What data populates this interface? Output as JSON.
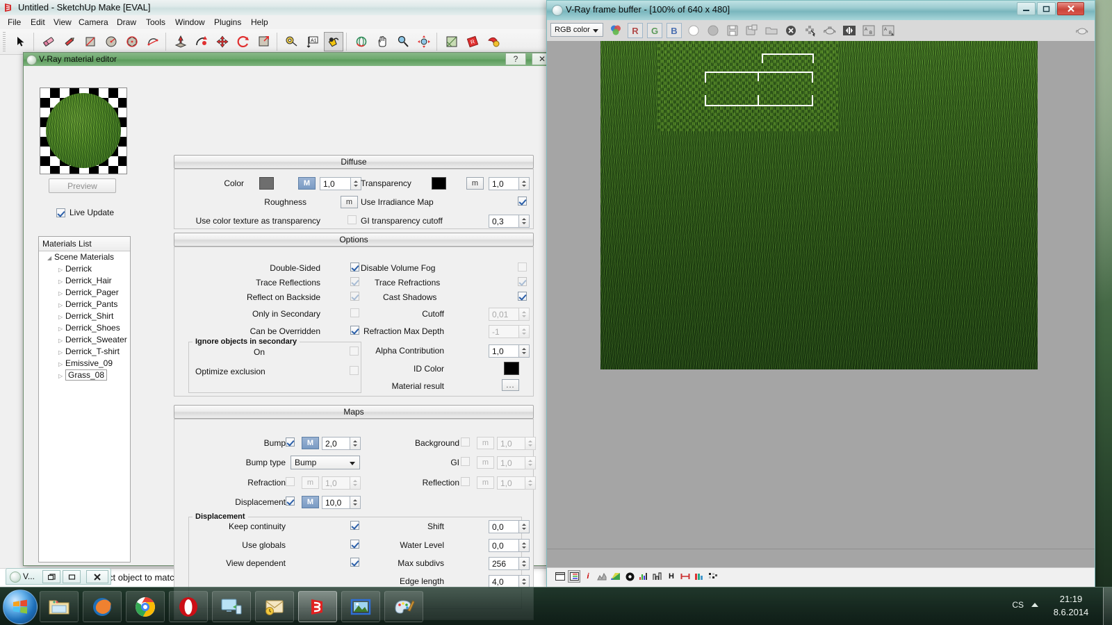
{
  "sketchup": {
    "title": "Untitled - SketchUp Make [EVAL]",
    "menu": [
      "File",
      "Edit",
      "View",
      "Camera",
      "Draw",
      "Tools",
      "Window",
      "Plugins",
      "Help"
    ],
    "toolbar_icons": [
      "select-arrow-icon",
      "eraser-icon",
      "pencil-icon",
      "rectangle-icon",
      "circle-icon",
      "polygon-icon",
      "arc-icon",
      "pushpull-icon",
      "follow-me-icon",
      "move-icon",
      "rotate-icon",
      "scale-icon",
      "tape-measure-icon",
      "text-icon",
      "paint-bucket-icon",
      "orbit-icon",
      "pan-icon",
      "zoom-icon",
      "zoom-extents-icon",
      "section-plane-icon",
      "vray-render-icon",
      "vray-materials-icon"
    ],
    "status_text": "ct object to match paint from"
  },
  "material_editor": {
    "title": "V-Ray material editor",
    "help_label": "?",
    "close_label": "✕",
    "preview_button": "Preview",
    "live_update_label": "Live Update",
    "live_update_checked": true,
    "materials_list": {
      "header": "Materials List",
      "root": "Scene Materials",
      "items": [
        "Derrick",
        "Derrick_Hair",
        "Derrick_Pager",
        "Derrick_Pants",
        "Derrick_Shirt",
        "Derrick_Shoes",
        "Derrick_Sweater",
        "Derrick_T-shirt",
        "Emissive_09",
        "Grass_08"
      ],
      "selected": "Grass_08"
    },
    "diffuse": {
      "header": "Diffuse",
      "color_label": "Color",
      "color_swatch": "#6e6e6e",
      "color_map_button": "M",
      "color_value": "1,0",
      "transparency_label": "Transparency",
      "transparency_swatch": "#000000",
      "transparency_map_button": "m",
      "transparency_value": "1,0",
      "roughness_label": "Roughness",
      "roughness_map_button": "m",
      "use_irradiance_map_label": "Use Irradiance Map",
      "use_irradiance_map_checked": true,
      "use_color_texture_label": "Use color texture as transparency",
      "use_color_texture_checked": false,
      "gi_transparency_cutoff_label": "GI transparency cutoff",
      "gi_transparency_cutoff_value": "0,3"
    },
    "options": {
      "header": "Options",
      "left": [
        {
          "label": "Double-Sided",
          "checked": true,
          "enabled": true
        },
        {
          "label": "Trace Reflections",
          "checked": true,
          "enabled": false
        },
        {
          "label": "Reflect on Backside",
          "checked": true,
          "enabled": false
        },
        {
          "label": "Only in Secondary",
          "checked": false,
          "enabled": true
        },
        {
          "label": "Can be Overridden",
          "checked": true,
          "enabled": true
        }
      ],
      "right": [
        {
          "label": "Disable Volume Fog",
          "checked": false,
          "enabled": true
        },
        {
          "label": "Trace Refractions",
          "checked": true,
          "enabled": false
        },
        {
          "label": "Cast Shadows",
          "checked": true,
          "enabled": true
        }
      ],
      "cutoff_label": "Cutoff",
      "cutoff_value": "0,01",
      "refraction_max_depth_label": "Refraction Max Depth",
      "refraction_max_depth_value": "-1",
      "alpha_contribution_label": "Alpha Contribution",
      "alpha_contribution_value": "1,0",
      "id_color_label": "ID Color",
      "id_color_swatch": "#000000",
      "material_result_label": "Material result",
      "material_result_button": "...",
      "ignore_group": {
        "title": "Ignore objects in secondary",
        "on_label": "On",
        "on_checked": false,
        "optimize_exclusion_label": "Optimize exclusion",
        "optimize_exclusion_checked": false
      }
    },
    "maps": {
      "header": "Maps",
      "bump_label": "Bump",
      "bump_checked": true,
      "bump_map_button": "M",
      "bump_value": "2,0",
      "bump_type_label": "Bump type",
      "bump_type_value": "Bump",
      "refraction_label": "Refraction",
      "refraction_checked": false,
      "refraction_map_button": "m",
      "refraction_value": "1,0",
      "displacement_label": "Displacement",
      "displacement_checked": true,
      "displacement_map_button": "M",
      "displacement_value": "10,0",
      "background_label": "Background",
      "background_checked": false,
      "background_map_button": "m",
      "background_value": "1,0",
      "gi_label": "GI",
      "gi_checked": false,
      "gi_map_button": "m",
      "gi_value": "1,0",
      "reflection_label": "Reflection",
      "reflection_checked": false,
      "reflection_map_button": "m",
      "reflection_value": "1,0",
      "displacement_group": {
        "title": "Displacement",
        "keep_continuity_label": "Keep continuity",
        "keep_continuity_checked": true,
        "use_globals_label": "Use globals",
        "use_globals_checked": true,
        "view_dependent_label": "View dependent",
        "view_dependent_checked": true,
        "shift_label": "Shift",
        "shift_value": "0,0",
        "water_level_label": "Water Level",
        "water_level_value": "0,0",
        "max_subdivs_label": "Max subdivs",
        "max_subdivs_value": "256",
        "edge_length_label": "Edge length",
        "edge_length_value": "4,0"
      }
    }
  },
  "frame_buffer": {
    "title": "V-Ray frame buffer - [100% of 640 x 480]",
    "minimize_label": "—",
    "maximize_label": "❐",
    "close_label": "✕",
    "channel_select": "RGB color",
    "channel_buttons": [
      {
        "label": "R",
        "color": "#b04a4a"
      },
      {
        "label": "G",
        "color": "#5b9a5b"
      },
      {
        "label": "B",
        "color": "#4a6fb0"
      }
    ],
    "toolbar_icons": [
      "color-wheel-icon",
      "alpha-white-icon",
      "alpha-grey-icon",
      "save-icon",
      "save-all-icon",
      "folder-open-icon",
      "clear-icon",
      "region-render-icon",
      "teapot-icon",
      "ab-swap-icon",
      "ab-horizontal-icon",
      "ab-vertical-icon"
    ],
    "bottom_icons": [
      "frame-stamp-icon",
      "color-corrections-icon",
      "info-icon",
      "curve-icon",
      "color-balance-icon",
      "exposure-icon",
      "hsv-icon",
      "lut-icon",
      "hue-icon",
      "levels-icon",
      "lights-icon",
      "pixel-icon"
    ],
    "render_info": "100% of 640 x 480"
  },
  "minimized_window": {
    "label": "V...",
    "restore_label": "❐",
    "maximize_label": "▭",
    "close_label": "✕"
  },
  "taskbar": {
    "start_label": "start-orb-icon",
    "items": [
      {
        "name": "windows-explorer-icon",
        "active": false
      },
      {
        "name": "firefox-icon",
        "active": false
      },
      {
        "name": "chrome-icon",
        "active": false
      },
      {
        "name": "opera-icon",
        "active": false
      },
      {
        "name": "remote-desktop-icon",
        "active": false
      },
      {
        "name": "outlook-icon",
        "active": false
      },
      {
        "name": "sketchup-icon",
        "active": true
      },
      {
        "name": "photo-viewer-icon",
        "active": false
      },
      {
        "name": "paint-icon",
        "active": false
      }
    ],
    "tray_language": "CS",
    "clock_time": "21:19",
    "clock_date": "8.6.2014"
  }
}
